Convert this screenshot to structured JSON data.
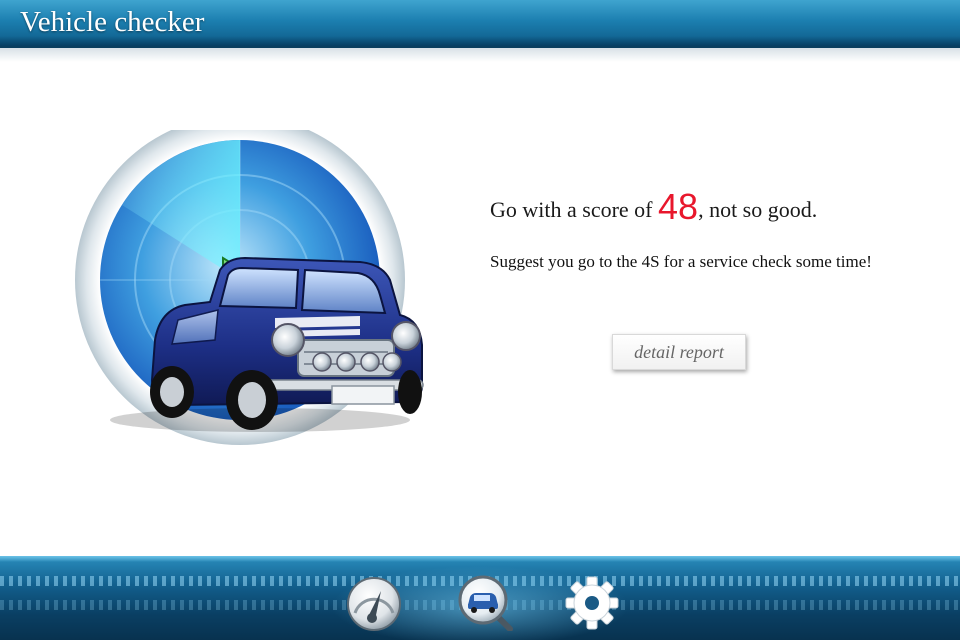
{
  "header": {
    "title": "Vehicle checker"
  },
  "result": {
    "score_prefix": "Go with a score of ",
    "score": "48",
    "score_suffix": ", not so good.",
    "suggestion": "Suggest you go to the 4S for a service check some time!",
    "score_color": "#e8172c"
  },
  "actions": {
    "detail_label": "detail report"
  },
  "nav": {
    "items": [
      {
        "id": "gauge",
        "icon": "speedometer-icon"
      },
      {
        "id": "check",
        "icon": "car-magnifier-icon"
      },
      {
        "id": "settings",
        "icon": "gear-icon"
      }
    ]
  },
  "colors": {
    "header": "#1c7fb0",
    "bottom_bar": "#0a3f63",
    "accent": "#e8172c"
  }
}
